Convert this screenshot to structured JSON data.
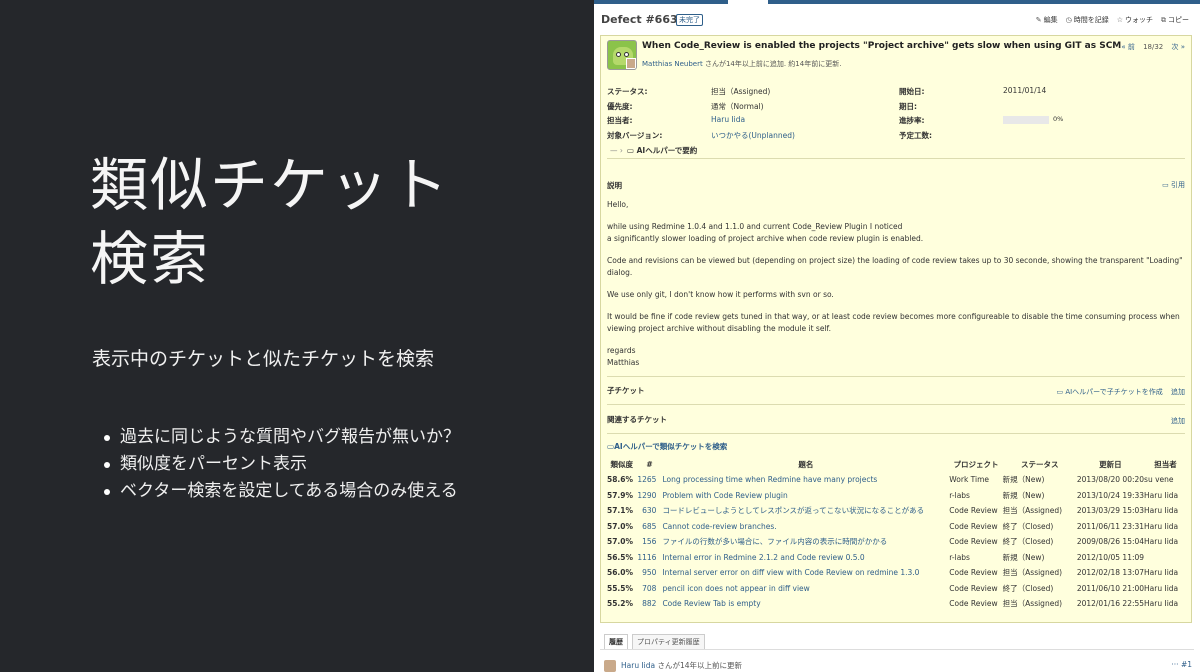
{
  "slide": {
    "title_line1": "類似チケット",
    "title_line2": "検索",
    "subtitle": "表示中のチケットと似たチケットを検索",
    "bullets": [
      "過去に同じような質問やバグ報告が無いか？",
      "類似度をパーセント表示",
      "ベクター検索を設定してある場合のみ使える"
    ]
  },
  "issue": {
    "id": "Defect #663",
    "badge": "未完了",
    "actions": [
      "編集",
      "時間を記録",
      "ウォッチ",
      "コピー"
    ],
    "action_icons": [
      "pencil-icon",
      "clock-icon",
      "star-icon",
      "copy-icon"
    ],
    "subject": "When Code_Review is enabled the projects \"Project archive\" gets slow when using GIT as SCM",
    "nav": {
      "prev": "« 前",
      "count": "18/32",
      "next": "次 »"
    },
    "author_name": "Matthias Neubert",
    "author_rest": " さんが14年以上前に追加. 約14年前に更新.",
    "attrs": {
      "status_label": "ステータス:",
      "status_value": "担当（Assigned)",
      "priority_label": "優先度:",
      "priority_value": "通常（Normal)",
      "assignee_label": "担当者:",
      "assignee_value": "Haru Iida",
      "version_label": "対象バージョン:",
      "version_value": "いつかやる(Unplanned)",
      "start_label": "開始日:",
      "start_value": "2011/01/14",
      "due_label": "期日:",
      "progress_label": "進捗率:",
      "progress_value": "0%",
      "progress": 0,
      "estimate_label": "予定工数:"
    },
    "ai_summary": "AIヘルパーで要約",
    "description_title": "説明",
    "quote": "引用",
    "description": [
      "Hello,",
      "while using Redmine 1.0.4 and 1.1.0 and current Code_Review Plugin I noticed",
      "a significantly slower loading of project archive when code review plugin is enabled.",
      "Code and revisions can be viewed but (depending on project size) the loading of code review takes up to 30 seconde, showing the transparent \"Loading\"",
      "dialog.",
      "We use only git, I don't know how it performs with svn or so.",
      "It would be fine if code review gets tuned in that way, or at least code review becomes more configureable to disable the time consuming process when",
      "viewing project archive without disabling the module it self.",
      "regards",
      "Matthias"
    ],
    "subtasks_title": "子チケット",
    "subtasks_ai": "AIヘルパーで子チケットを作成",
    "subtasks_add": "追加",
    "related_title": "関連するチケット",
    "related_add": "追加",
    "ai_similar": "AIヘルパーで類似チケットを検索",
    "similar_headers": [
      "類似度",
      "#",
      "題名",
      "プロジェクト",
      "ステータス",
      "更新日",
      "担当者"
    ],
    "similar_rows": [
      [
        "58.6%",
        "1265",
        "Long processing time when Redmine have many projects",
        "Work Time",
        "新規（New)",
        "2013/08/20 00:20",
        "su vene"
      ],
      [
        "57.9%",
        "1290",
        "Problem with Code Review plugin",
        "r-labs",
        "新規（New)",
        "2013/10/24 19:33",
        "Haru Iida"
      ],
      [
        "57.1%",
        "630",
        "コードレビューしようとしてレスポンスが返ってこない状況になることがある",
        "Code Review",
        "担当（Assigned)",
        "2013/03/29 15:03",
        "Haru Iida"
      ],
      [
        "57.0%",
        "685",
        "Cannot code-review branches.",
        "Code Review",
        "終了（Closed)",
        "2011/06/11 23:31",
        "Haru Iida"
      ],
      [
        "57.0%",
        "156",
        "ファイルの行数が多い場合に、ファイル内容の表示に時間がかかる",
        "Code Review",
        "終了（Closed)",
        "2009/08/26 15:04",
        "Haru Iida"
      ],
      [
        "56.5%",
        "1116",
        "Internal error in Redmine 2.1.2 and Code review 0.5.0",
        "r-labs",
        "新規（New)",
        "2012/10/05 11:09",
        ""
      ],
      [
        "56.0%",
        "950",
        "Internal server error on diff view with Code Review on redmine 1.3.0",
        "Code Review",
        "担当（Assigned)",
        "2012/02/18 13:07",
        "Haru Iida"
      ],
      [
        "55.5%",
        "708",
        "pencil icon does not appear in diff view",
        "Code Review",
        "終了（Closed)",
        "2011/06/10 21:00",
        "Haru Iida"
      ],
      [
        "55.2%",
        "882",
        "Code Review Tab is empty",
        "Code Review",
        "担当（Assigned)",
        "2012/01/16 22:55",
        "Haru Iida"
      ]
    ],
    "tabs": [
      "履歴",
      "プロパティ更新履歴"
    ],
    "journal_user": "Haru Iida",
    "journal_rest": " さんが14年以上前に更新",
    "journal_right": "··· #1"
  }
}
